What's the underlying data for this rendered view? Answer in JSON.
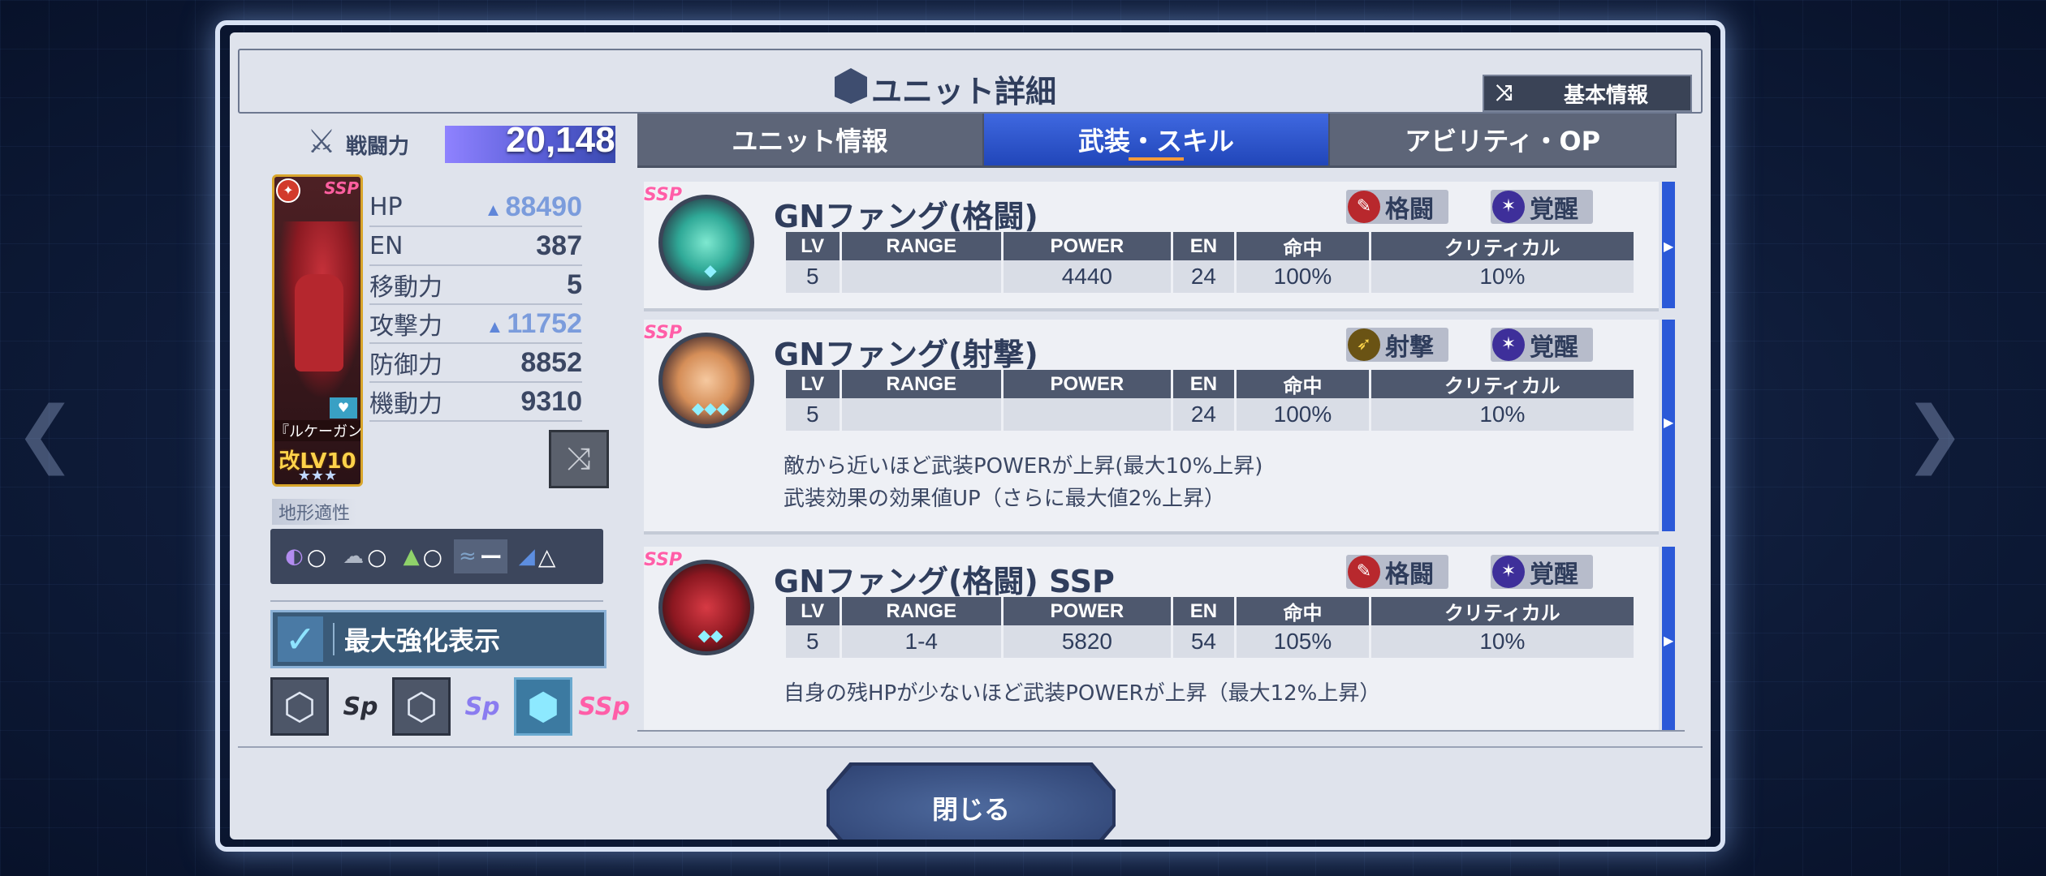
{
  "window": {
    "title": "ユニット詳細",
    "basic_info_label": "基本情報"
  },
  "unit": {
    "power_label": "戦闘力",
    "power_value": "20,148",
    "card_name": "『ルケーガンダ』",
    "card_level": "改LV10",
    "card_rank": "SSP",
    "stars": "★★★",
    "stats": [
      {
        "name": "HP",
        "value": "88490",
        "boosted": true
      },
      {
        "name": "EN",
        "value": "387",
        "boosted": false
      },
      {
        "name": "移動力",
        "value": "5",
        "boosted": false
      },
      {
        "name": "攻撃力",
        "value": "11752",
        "boosted": true
      },
      {
        "name": "防御力",
        "value": "8852",
        "boosted": false
      },
      {
        "name": "機動力",
        "value": "9310",
        "boosted": false
      }
    ],
    "terrain_label": "地形適性",
    "terrain": [
      {
        "icon": "space-icon",
        "glyph": "◐",
        "value": "○"
      },
      {
        "icon": "air-icon",
        "glyph": "☁",
        "value": "○"
      },
      {
        "icon": "ground-icon",
        "glyph": "▲",
        "value": "○"
      },
      {
        "icon": "water-icon",
        "glyph": "≈",
        "value": "ー"
      },
      {
        "icon": "underground-icon",
        "glyph": "◢",
        "value": "△"
      }
    ],
    "max_enhance_label": "最大強化表示",
    "max_enhance_checked": true
  },
  "tabs": [
    {
      "label": "ユニット情報",
      "active": false
    },
    {
      "label": "武装・スキル",
      "active": true
    },
    {
      "label": "アビリティ・OP",
      "active": false
    }
  ],
  "table_headers": [
    "LV",
    "RANGE",
    "POWER",
    "EN",
    "命中",
    "クリティカル"
  ],
  "weapons": [
    {
      "name": "GNファング(格闘)",
      "rank": "SSP",
      "tags": [
        {
          "icon": "melee-icon",
          "label": "格闘"
        },
        {
          "icon": "awaken-icon",
          "label": "覚醒"
        }
      ],
      "row": [
        "5",
        "",
        "4440",
        "24",
        "100%",
        "10%"
      ],
      "desc": []
    },
    {
      "name": "GNファング(射撃)",
      "rank": "SSP",
      "tags": [
        {
          "icon": "shoot-icon",
          "label": "射撃"
        },
        {
          "icon": "awaken-icon",
          "label": "覚醒"
        }
      ],
      "row": [
        "5",
        "",
        "",
        "24",
        "100%",
        "10%"
      ],
      "desc": [
        "敵から近いほど武装POWERが上昇(最大10%上昇)",
        "武装効果の効果値UP（さらに最大値2%上昇）"
      ]
    },
    {
      "name": "GNファング(格闘) SSP",
      "rank": "SSP",
      "tags": [
        {
          "icon": "melee-icon",
          "label": "格闘"
        },
        {
          "icon": "awaken-icon",
          "label": "覚醒"
        }
      ],
      "row": [
        "5",
        "1-4",
        "5820",
        "54",
        "105%",
        "10%"
      ],
      "desc": [
        "自身の残HPが少ないほど武装POWERが上昇（最大12%上昇）"
      ]
    }
  ],
  "close_label": "閉じる"
}
